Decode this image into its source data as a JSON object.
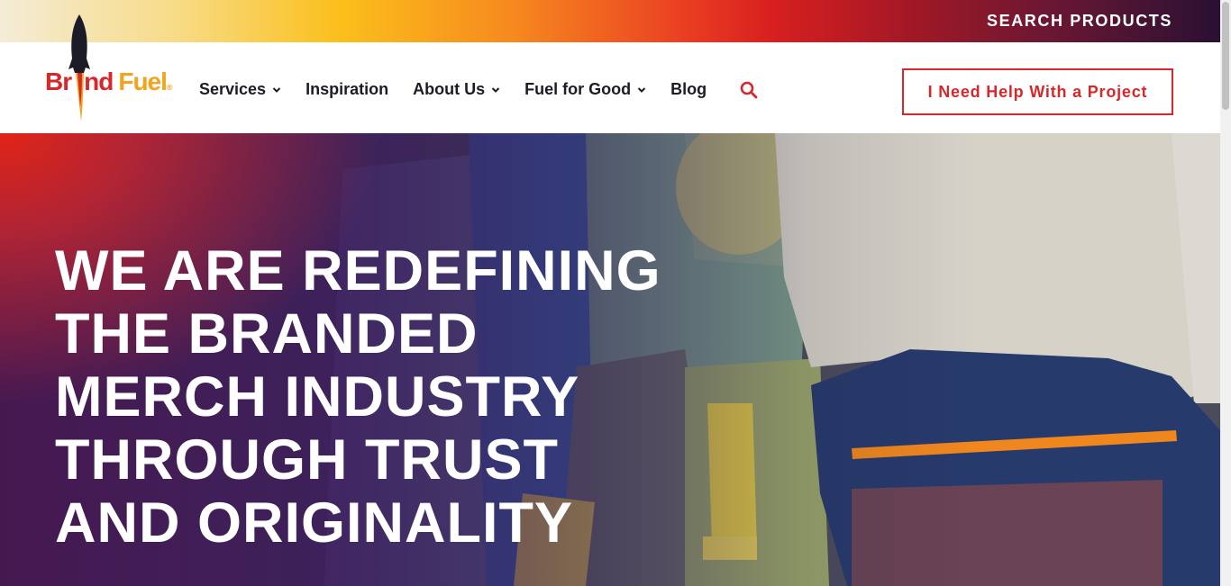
{
  "topbar": {
    "search_products": "SEARCH PRODUCTS"
  },
  "logo": {
    "brand_text": "Br",
    "brand_text_2": "nd",
    "fuel_text": "Fuel",
    "reg_mark": "®",
    "icon": "rocket-icon"
  },
  "nav": {
    "items": [
      {
        "label": "Services",
        "has_dropdown": true
      },
      {
        "label": "Inspiration",
        "has_dropdown": false
      },
      {
        "label": "About Us",
        "has_dropdown": true
      },
      {
        "label": "Fuel for Good",
        "has_dropdown": true
      },
      {
        "label": "Blog",
        "has_dropdown": false
      }
    ],
    "search_icon": "search-icon"
  },
  "cta": {
    "label": "I Need Help With a Project"
  },
  "hero": {
    "headline": "WE ARE REDEFINING THE BRANDED MERCH INDUSTRY THROUGH TRUST AND ORIGINALITY"
  },
  "colors": {
    "brand_red": "#d6282a",
    "brand_orange": "#f4a41c",
    "nav_text": "#1c1c28"
  }
}
